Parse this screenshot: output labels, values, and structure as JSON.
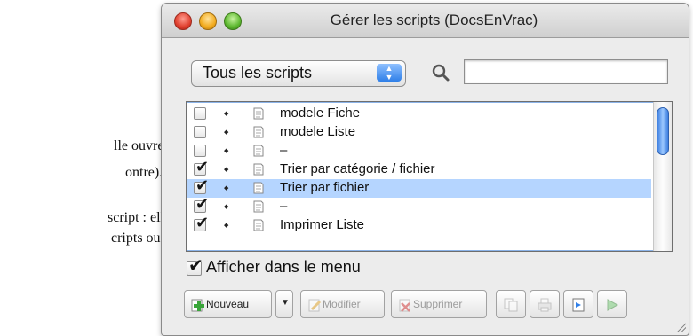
{
  "background_text": {
    "line1": "lle ouvre un",
    "line2": "ontre).",
    "line3": "script : elle",
    "line4": "cripts ou s'il"
  },
  "window": {
    "title": "Gérer les scripts (DocsEnVrac)"
  },
  "filter": {
    "selected": "Tous les scripts"
  },
  "search": {
    "value": "",
    "placeholder": ""
  },
  "scripts": [
    {
      "label": "modele Fiche",
      "checked": false,
      "selected": false
    },
    {
      "label": "modele Liste",
      "checked": false,
      "selected": false
    },
    {
      "label": "–",
      "checked": false,
      "selected": false
    },
    {
      "label": "Trier par catégorie / fichier",
      "checked": true,
      "selected": false
    },
    {
      "label": "Trier par fichier",
      "checked": true,
      "selected": true
    },
    {
      "label": "–",
      "checked": true,
      "selected": false
    },
    {
      "label": "Imprimer Liste",
      "checked": true,
      "selected": false
    }
  ],
  "show_in_menu": {
    "label": "Afficher dans le menu",
    "checked": true
  },
  "toolbar": {
    "new_label": "Nouveau",
    "edit_label": "Modifier",
    "delete_label": "Supprimer"
  },
  "colors": {
    "selection": "#b5d5ff",
    "accent": "#2f7fe8"
  }
}
